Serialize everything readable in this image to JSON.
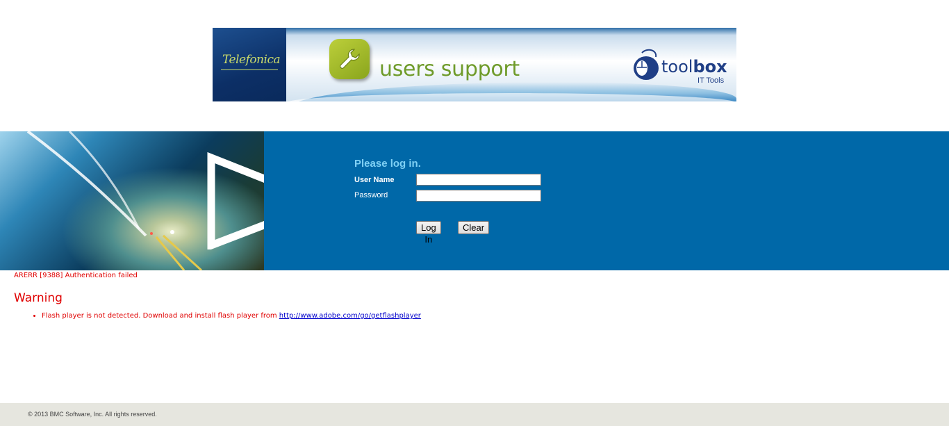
{
  "banner": {
    "brand": "Telefonica",
    "title": "users support",
    "toolbox_prefix": "tool",
    "toolbox_suffix": "box",
    "toolbox_sub": "IT Tools",
    "wrench_icon": "wrench-icon",
    "mouse_icon": "mouse-icon",
    "colors": {
      "left_panel": "#0c2f66",
      "title": "#6f9b2a",
      "toolbox": "#203f86"
    }
  },
  "login": {
    "heading": "Please log in.",
    "username_label": "User Name",
    "password_label": "Password",
    "username_value": "",
    "password_value": "",
    "login_button": "Log In",
    "clear_button": "Clear",
    "band_color": "#0068a8",
    "heading_color": "#7fd0f4"
  },
  "error": {
    "message": "ARERR [9388] Authentication failed"
  },
  "warning": {
    "heading": "Warning",
    "items": [
      {
        "text": "Flash player is not detected. Download and install flash player from ",
        "link": "http://www.adobe.com/go/getflashplayer"
      }
    ],
    "color": "#e00000"
  },
  "footer": {
    "copyright": "© 2013 BMC Software, Inc. All rights reserved."
  }
}
